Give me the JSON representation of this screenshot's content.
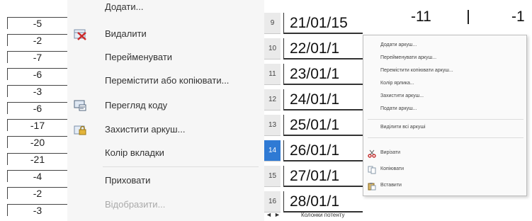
{
  "left_column": {
    "values": [
      "-5",
      "-2",
      "-7",
      "-6",
      "-3",
      "-6",
      "-17",
      "-20",
      "-21",
      "-4",
      "-2",
      "-3"
    ]
  },
  "context_menu": {
    "items": [
      {
        "label": "Додати...",
        "icon": "",
        "disabled": false
      },
      {
        "label": "Видалити",
        "icon": "delete-sheet-icon",
        "disabled": false
      },
      {
        "label": "Перейменувати",
        "icon": "",
        "disabled": false
      },
      {
        "label": "Перемістити або копіювати...",
        "icon": "",
        "disabled": false
      },
      {
        "label": "Перегляд коду",
        "icon": "view-code-icon",
        "disabled": false
      },
      {
        "label": "Захистити аркуш...",
        "icon": "protect-sheet-icon",
        "disabled": false
      },
      {
        "label": "Колір вкладки",
        "icon": "",
        "disabled": false
      },
      {
        "label": "Приховати",
        "icon": "",
        "disabled": false
      },
      {
        "label": "Відобразити...",
        "icon": "",
        "disabled": true
      }
    ]
  },
  "sheet": {
    "rows": [
      {
        "header": "9",
        "date": "21/01/15",
        "selected": false
      },
      {
        "header": "10",
        "date": "22/01/1",
        "selected": false
      },
      {
        "header": "11",
        "date": "23/01/1",
        "selected": false
      },
      {
        "header": "12",
        "date": "24/01/1",
        "selected": false
      },
      {
        "header": "13",
        "date": "25/01/1",
        "selected": false
      },
      {
        "header": "14",
        "date": "26/01/1",
        "selected": true
      },
      {
        "header": "15",
        "date": "27/01/1",
        "selected": false
      },
      {
        "header": "16",
        "date": "28/01/1",
        "selected": false
      }
    ],
    "top_values": [
      "-11",
      "-1"
    ],
    "selected_row_color": "#2f7ad4"
  },
  "submenu": {
    "items": [
      {
        "label": "Додати аркуш..."
      },
      {
        "label": "Перейменувати аркуш..."
      },
      {
        "label": "Перемістити копіювати аркуш..."
      },
      {
        "label": "Колір ярлика..."
      },
      {
        "label": "Захистити аркуш..."
      },
      {
        "label": "Подати аркуш..."
      },
      {
        "label": "Виділити всі аркуші"
      },
      {
        "label": "Вирізати",
        "icon": "cut-icon"
      },
      {
        "label": "Копіювати",
        "icon": "copy-icon"
      },
      {
        "label": "Вставити",
        "icon": "paste-icon"
      }
    ]
  },
  "bottom": {
    "nav_prev": "◄",
    "nav_next": "►",
    "text": "Колонки потенту"
  }
}
